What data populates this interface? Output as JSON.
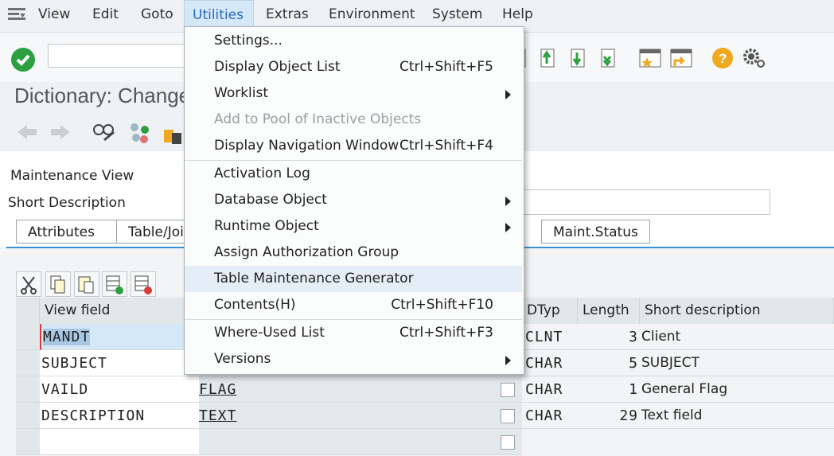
{
  "menubar": {
    "items": [
      "View",
      "Edit",
      "Goto",
      "Utilities",
      "Extras",
      "Environment",
      "System",
      "Help"
    ]
  },
  "page": {
    "title": "Dictionary: Change"
  },
  "fields": {
    "maintenance_view_label": "Maintenance View",
    "short_description_label": "Short Description"
  },
  "tabs": [
    "Attributes",
    "Table/Joi",
    "Maint.Status"
  ],
  "table": {
    "headers": [
      "View field",
      "DTyp",
      "Length",
      "Short description"
    ],
    "rows": [
      {
        "view_field": "MANDT",
        "field": "",
        "dtyp": "CLNT",
        "length": "3",
        "desc": "Client"
      },
      {
        "view_field": "SUBJECT",
        "field": "",
        "dtyp": "CHAR",
        "length": "5",
        "desc": "SUBJECT"
      },
      {
        "view_field": "VAILD",
        "field": "FLAG",
        "dtyp": "CHAR",
        "length": "1",
        "desc": "General Flag"
      },
      {
        "view_field": "DESCRIPTION",
        "field": "TEXT",
        "dtyp": "CHAR",
        "length": "29",
        "desc": "Text field"
      }
    ]
  },
  "dropdown": {
    "items": [
      {
        "label": "Settings...",
        "shortcut": ""
      },
      {
        "label": "Display Object List",
        "shortcut": "Ctrl+Shift+F5"
      },
      {
        "label": "Worklist",
        "shortcut": ""
      },
      {
        "label": "Add to Pool of Inactive Objects",
        "shortcut": ""
      },
      {
        "label": "Display Navigation Window",
        "shortcut": "Ctrl+Shift+F4"
      },
      {
        "label": "Activation Log",
        "shortcut": ""
      },
      {
        "label": "Database Object",
        "shortcut": ""
      },
      {
        "label": "Runtime Object",
        "shortcut": ""
      },
      {
        "label": "Assign Authorization Group",
        "shortcut": ""
      },
      {
        "label": "Table Maintenance Generator",
        "shortcut": ""
      },
      {
        "label": "Contents(H)",
        "shortcut": "Ctrl+Shift+F10"
      },
      {
        "label": "Where-Used List",
        "shortcut": "Ctrl+Shift+F3"
      },
      {
        "label": "Versions",
        "shortcut": ""
      }
    ]
  },
  "colors": {
    "accent": "#2a6bb8",
    "confirm": "#2ca040",
    "help": "#f0a820"
  }
}
